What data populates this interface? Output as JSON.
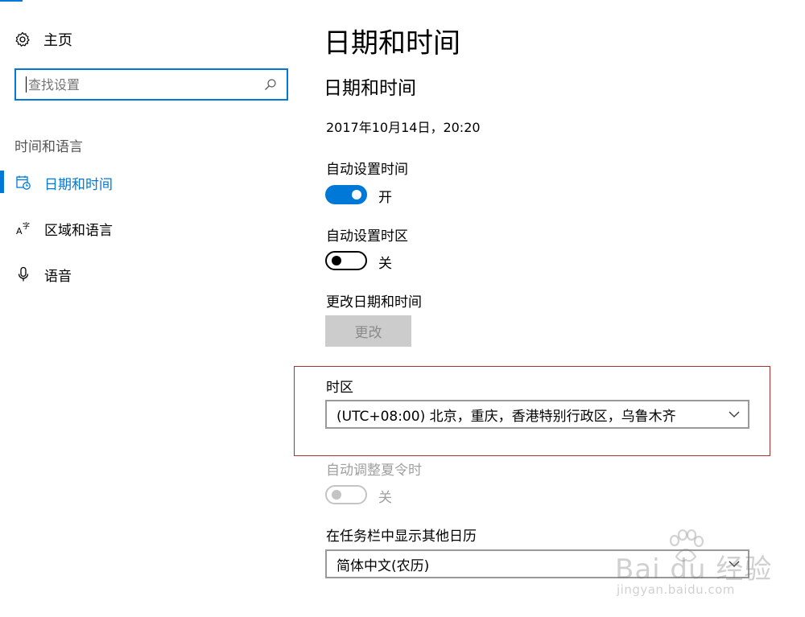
{
  "sidebar": {
    "home_label": "主页",
    "search_placeholder": "查找设置",
    "section_label": "时间和语言",
    "items": [
      {
        "label": "日期和时间",
        "icon": "calendar-clock-icon",
        "active": true
      },
      {
        "label": "区域和语言",
        "icon": "language-icon",
        "active": false
      },
      {
        "label": "语音",
        "icon": "microphone-icon",
        "active": false
      }
    ]
  },
  "main": {
    "page_title": "日期和时间",
    "section_title": "日期和时间",
    "current_datetime": "2017年10月14日，20:20",
    "auto_time": {
      "label": "自动设置时间",
      "state_text": "开",
      "on": true
    },
    "auto_timezone": {
      "label": "自动设置时区",
      "state_text": "关",
      "on": false
    },
    "change_datetime": {
      "label": "更改日期和时间",
      "button_label": "更改"
    },
    "timezone": {
      "label": "时区",
      "selected": "(UTC+08:00) 北京，重庆，香港特别行政区，乌鲁木齐"
    },
    "dst": {
      "label": "自动调整夏令时",
      "state_text": "关",
      "on": false,
      "disabled": true
    },
    "other_calendar": {
      "label": "在任务栏中显示其他日历",
      "selected": "简体中文(农历)"
    }
  },
  "watermark": {
    "brand": "Bai du 经验",
    "url": "jingyan.baidu.com"
  },
  "colors": {
    "accent": "#0078d7",
    "highlight_border": "#b03030",
    "disabled": "#a0a0a0"
  }
}
